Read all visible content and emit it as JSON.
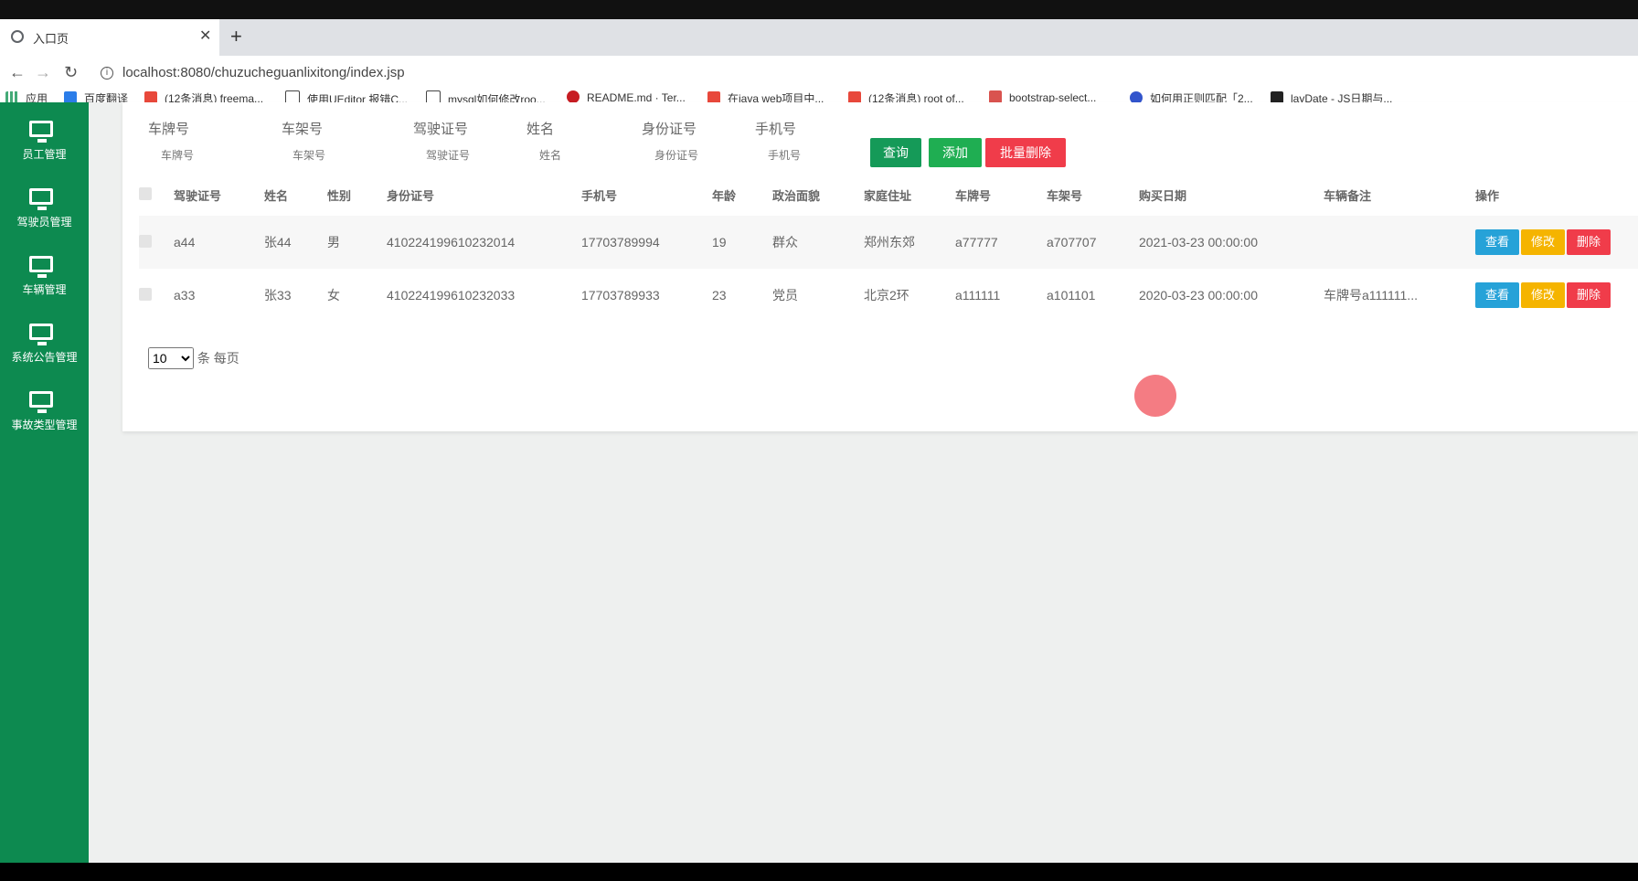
{
  "browser": {
    "tab_title": "入口页",
    "new_tab": "+",
    "url": "localhost:8080/chuzucheguanlixitong/index.jsp",
    "bookmarks": [
      {
        "label": "应用",
        "icon": "apps-grid-icon"
      },
      {
        "label": "百度翻译",
        "icon": "baidu-translate-icon"
      },
      {
        "label": "(12条消息) freema...",
        "icon": "csdn-icon"
      },
      {
        "label": "使用UEditor 报错C...",
        "icon": "link-icon"
      },
      {
        "label": "mysql如何修改roo...",
        "icon": "link-icon"
      },
      {
        "label": "README.md · Ter...",
        "icon": "gitee-icon"
      },
      {
        "label": "在java web项目中...",
        "icon": "csdn-icon"
      },
      {
        "label": "(12条消息) root of...",
        "icon": "csdn-icon"
      },
      {
        "label": "bootstrap-select...",
        "icon": "bookmark-icon"
      },
      {
        "label": "如何用正则匹配「2...",
        "icon": "baidu-icon"
      },
      {
        "label": "layDate - JS日期与...",
        "icon": "laydate-icon"
      }
    ]
  },
  "sidebar": {
    "items": [
      {
        "label": "员工管理"
      },
      {
        "label": "驾驶员管理"
      },
      {
        "label": "车辆管理"
      },
      {
        "label": "系统公告管理"
      },
      {
        "label": "事故类型管理"
      }
    ]
  },
  "search": {
    "fields": [
      {
        "label": "车牌号",
        "placeholder": "车牌号"
      },
      {
        "label": "车架号",
        "placeholder": "车架号"
      },
      {
        "label": "驾驶证号",
        "placeholder": "驾驶证号"
      },
      {
        "label": "姓名",
        "placeholder": "姓名"
      },
      {
        "label": "身份证号",
        "placeholder": "身份证号"
      },
      {
        "label": "手机号",
        "placeholder": "手机号"
      }
    ],
    "query_label": "查询",
    "add_label": "添加",
    "batch_delete_label": "批量删除"
  },
  "table": {
    "headers": [
      "驾驶证号",
      "姓名",
      "性别",
      "身份证号",
      "手机号",
      "年龄",
      "政治面貌",
      "家庭住址",
      "车牌号",
      "车架号",
      "购买日期",
      "车辆备注",
      "操作"
    ],
    "rows": [
      [
        "a44",
        "张44",
        "男",
        "410224199610232014",
        "17703789994",
        "19",
        "群众",
        "郑州东郊",
        "a77777",
        "a707707",
        "2021-03-23 00:00:00",
        ""
      ],
      [
        "a33",
        "张33",
        "女",
        "410224199610232033",
        "17703789933",
        "23",
        "党员",
        "北京2环",
        "a111111",
        "a101101",
        "2020-03-23 00:00:00",
        "车牌号a111111..."
      ]
    ],
    "actions": {
      "view": "查看",
      "edit": "修改",
      "delete": "删除"
    }
  },
  "pager": {
    "page_size": "10",
    "suffix": "条 每页"
  },
  "colors": {
    "sidebar": "#0d8a50",
    "query": "#159a58",
    "add": "#1fae52",
    "danger": "#f03c4a",
    "view": "#26a2d8",
    "edit": "#f5b400"
  }
}
